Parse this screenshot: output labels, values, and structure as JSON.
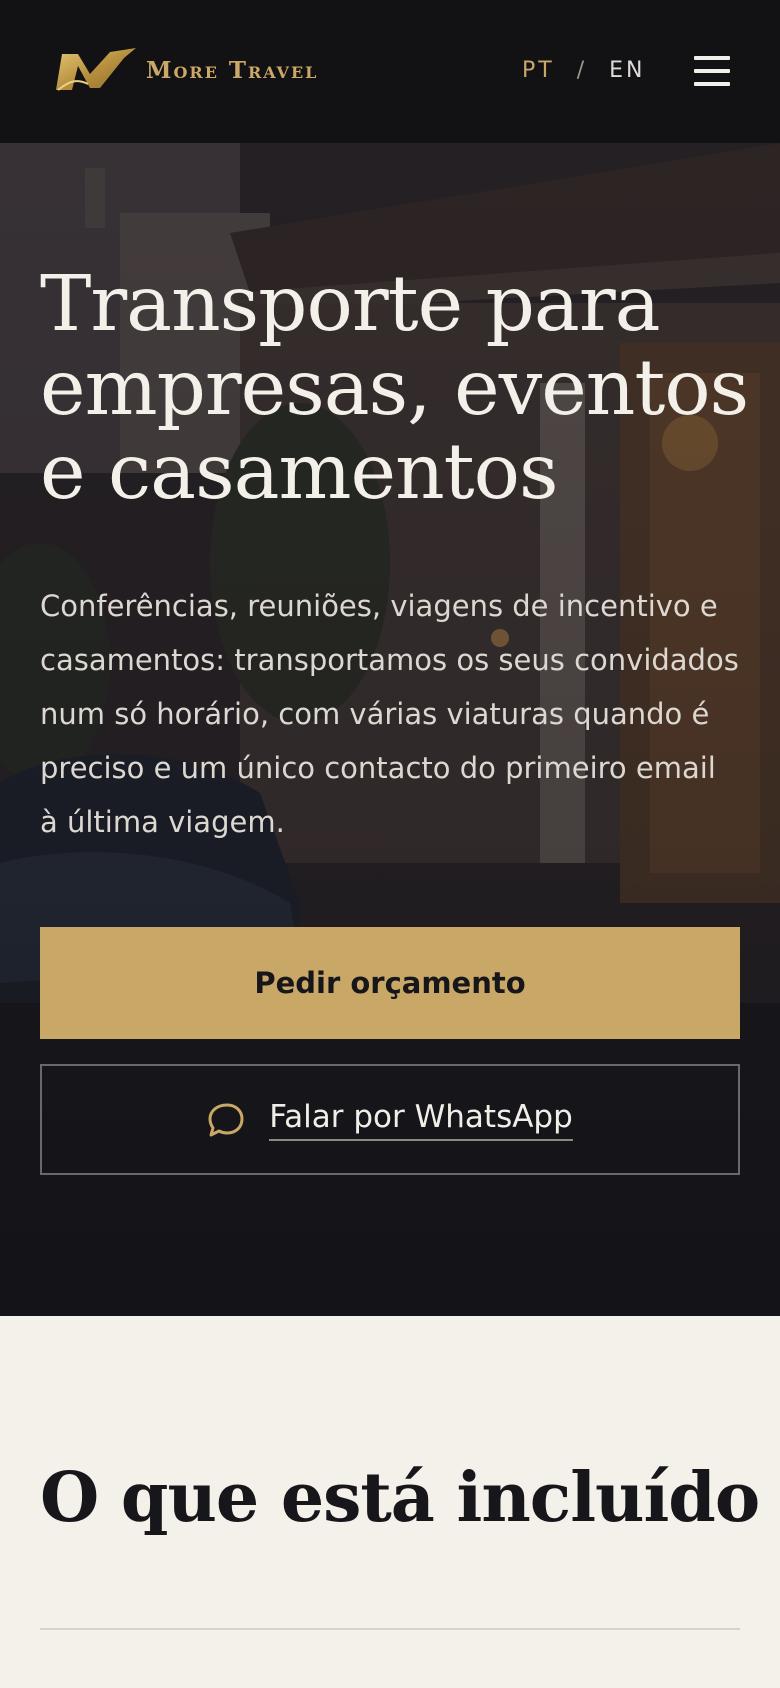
{
  "header": {
    "brand": "More Travel",
    "lang_pt": "PT",
    "lang_separator": "/",
    "lang_en": "EN",
    "accent_color": "#c9a867",
    "menu_icon": "hamburger-menu-icon"
  },
  "hero": {
    "title": "Transporte para empresas, eventos e casamentos",
    "description": "Conferências, reuniões, viagens de incentivo e casamentos: transportamos os seus convidados num só horário, com várias viaturas quando é preciso e um único contacto do primeiro email à última viagem.",
    "primary_button": "Pedir orçamento",
    "secondary_button": "Falar por WhatsApp",
    "secondary_icon": "chat-bubble-icon"
  },
  "included": {
    "title": "O que está incluído"
  }
}
